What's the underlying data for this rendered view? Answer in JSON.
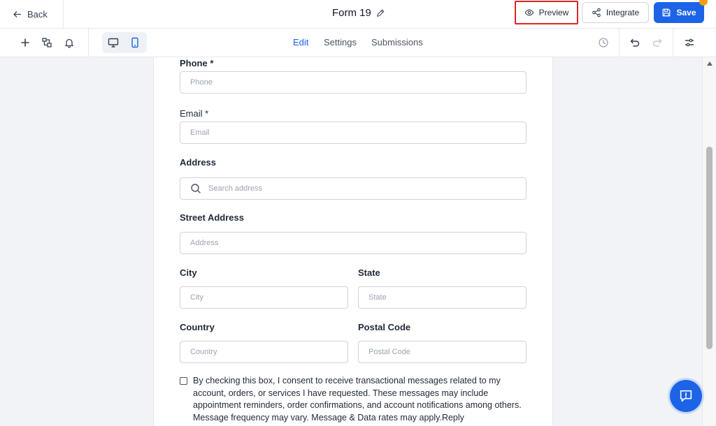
{
  "header": {
    "back_label": "Back",
    "form_title": "Form 19",
    "preview_label": "Preview",
    "integrate_label": "Integrate",
    "save_label": "Save"
  },
  "tabs": [
    {
      "label": "Edit",
      "active": true
    },
    {
      "label": "Settings",
      "active": false
    },
    {
      "label": "Submissions",
      "active": false
    }
  ],
  "form": {
    "phone": {
      "label": "Phone *",
      "placeholder": "Phone"
    },
    "email": {
      "label": "Email *",
      "placeholder": "Email"
    },
    "address": {
      "label": "Address",
      "placeholder": "Search address"
    },
    "street": {
      "label": "Street Address",
      "placeholder": "Address"
    },
    "city": {
      "label": "City",
      "placeholder": "City"
    },
    "state": {
      "label": "State",
      "placeholder": "State"
    },
    "country": {
      "label": "Country",
      "placeholder": "Country"
    },
    "postal": {
      "label": "Postal Code",
      "placeholder": "Postal Code"
    },
    "consent_text": "By checking this box, I consent to receive transactional messages related to my account, orders, or services I have requested. These messages may include appointment reminders, order confirmations, and account notifications among others. Message frequency may vary. Message & Data rates may apply.Reply"
  },
  "colors": {
    "accent": "#1d63e6",
    "highlight": "#dc2626",
    "notification": "#f59e0b"
  }
}
